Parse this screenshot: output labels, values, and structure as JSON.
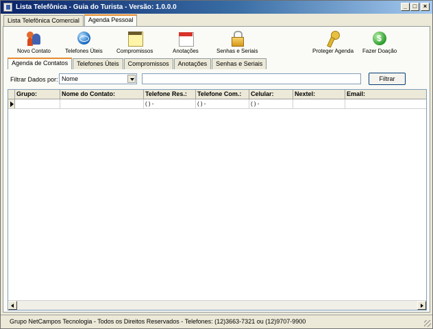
{
  "window": {
    "title": "Lista Telefônica - Guia do Turista - Versão: 1.0.0.0",
    "controls": {
      "minimize": "_",
      "maximize": "□",
      "close": "×"
    }
  },
  "top_tabs": [
    {
      "label": "Lista Telefônica Comercial",
      "active": false
    },
    {
      "label": "Agenda Pessoal",
      "active": true
    }
  ],
  "toolbar": {
    "items": [
      {
        "label": "Novo Contato",
        "icon": "users-icon"
      },
      {
        "label": "Telefones Úteis",
        "icon": "globe-icon"
      },
      {
        "label": "Compromissos",
        "icon": "notepad-icon"
      },
      {
        "label": "Anotações",
        "icon": "calendar-icon"
      },
      {
        "label": "Senhas e Seriais",
        "icon": "lock-icon"
      },
      {
        "label": "Proteger Agenda",
        "icon": "key-icon"
      },
      {
        "label": "Fazer Doação",
        "icon": "money-icon"
      }
    ]
  },
  "sub_tabs": [
    {
      "label": "Agenda de Contatos",
      "active": true
    },
    {
      "label": "Telefones Úteis",
      "active": false
    },
    {
      "label": "Compromissos",
      "active": false
    },
    {
      "label": "Anotações",
      "active": false
    },
    {
      "label": "Senhas e Seriais",
      "active": false
    }
  ],
  "filter": {
    "label": "Filtrar Dados por:",
    "field_value": "Nome",
    "search_value": "",
    "button_label": "Filtrar"
  },
  "grid": {
    "columns": [
      "Grupo:",
      "Nome do Contato:",
      "Telefone Res.:",
      "Telefone Com.:",
      "Celular:",
      "Nextel:",
      "Email:"
    ],
    "rows": [
      [
        "",
        "",
        "(  )    -",
        "(  )    -",
        "(  )    -",
        "",
        ""
      ]
    ]
  },
  "status": {
    "text": "Grupo NetCampos Tecnologia - Todos os Direitos Reservados - Telefones: (12)3663-7321 ou (12)9707-9900"
  }
}
